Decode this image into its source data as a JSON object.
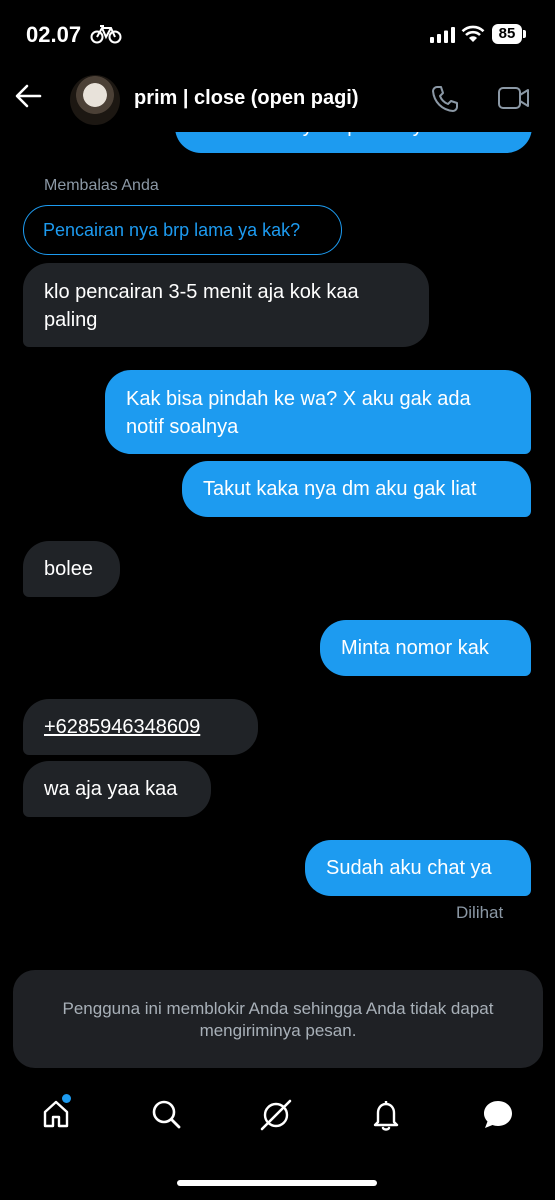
{
  "status_bar": {
    "time": "02.07",
    "battery": "85"
  },
  "header": {
    "contact_name": "prim | close (open pagi)"
  },
  "messages": {
    "cut_off_top": "Pencairan nya brp lama ya kak?",
    "reply_label": "Membalas Anda",
    "reply_quote": "Pencairan nya brp lama ya kak?",
    "m1": "klo pencairan 3-5 menit aja kok kaa paling",
    "m2": "Kak bisa pindah ke wa? X aku gak ada notif soalnya",
    "m3": "Takut kaka nya dm aku gak liat",
    "m4": "bolee",
    "m5": "Minta nomor kak",
    "m6": "+6285946348609",
    "m7": "wa aja yaa kaa",
    "m8": "Sudah aku chat ya",
    "seen": "Dilihat"
  },
  "notice": {
    "text": "Pengguna ini memblokir Anda sehingga Anda tidak dapat mengiriminya pesan."
  },
  "nav": {
    "items": [
      "home-icon",
      "search-icon",
      "grok-icon",
      "bell-icon",
      "messages-icon"
    ]
  },
  "colors": {
    "accent": "#1d9bf0",
    "incoming_bubble": "#202327",
    "background": "#000000"
  }
}
